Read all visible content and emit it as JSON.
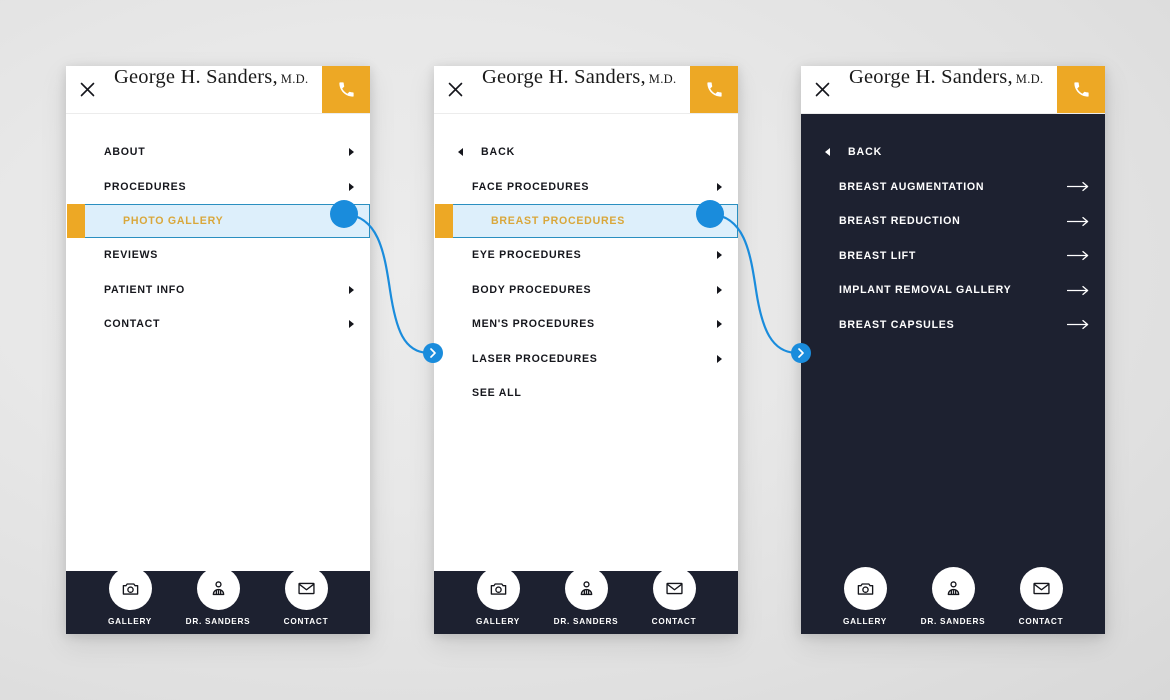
{
  "theme": {
    "accent_orange": "#eda825",
    "highlight_blue_bg": "#ddeffb",
    "highlight_blue_border": "#2a8fc0",
    "connector_blue": "#1a8cdc",
    "dark": "#1d2130",
    "gold_text": "#d9a73b",
    "page_background": "#e6e6e6"
  },
  "brand": {
    "name": "George H. Sanders,",
    "suffix": "M.D.",
    "close_icon": "close-icon",
    "phone_icon": "phone-icon"
  },
  "footer": {
    "items": [
      {
        "label": "Gallery",
        "display": "GALLERY",
        "icon": "camera-icon"
      },
      {
        "label": "Dr. Sanders",
        "display": "DR. SANDERS",
        "icon": "doctor-icon"
      },
      {
        "label": "Contact",
        "display": "CONTACT",
        "icon": "envelope-icon"
      }
    ]
  },
  "panels": [
    {
      "id": "main-menu",
      "theme": "light",
      "items": [
        {
          "label": "ABOUT",
          "arrow": "triangle-right",
          "state": "normal"
        },
        {
          "label": "PROCEDURES",
          "arrow": "triangle-right",
          "state": "normal"
        },
        {
          "label": "PHOTO GALLERY",
          "arrow": "triangle-right",
          "state": "active"
        },
        {
          "label": "REVIEWS",
          "arrow": "none",
          "state": "normal"
        },
        {
          "label": "PATIENT INFO",
          "arrow": "triangle-right",
          "state": "normal"
        },
        {
          "label": "CONTACT",
          "arrow": "triangle-right",
          "state": "normal"
        }
      ]
    },
    {
      "id": "procedures-menu",
      "theme": "light",
      "items": [
        {
          "label": "BACK",
          "arrow": "triangle-left",
          "state": "back"
        },
        {
          "label": "FACE PROCEDURES",
          "arrow": "triangle-right",
          "state": "normal"
        },
        {
          "label": "BREAST PROCEDURES",
          "arrow": "triangle-right",
          "state": "active"
        },
        {
          "label": "EYE PROCEDURES",
          "arrow": "triangle-right",
          "state": "normal"
        },
        {
          "label": "BODY PROCEDURES",
          "arrow": "triangle-right",
          "state": "normal"
        },
        {
          "label": "MEN'S PROCEDURES",
          "arrow": "triangle-right",
          "state": "normal"
        },
        {
          "label": "LASER PROCEDURES",
          "arrow": "triangle-right",
          "state": "normal"
        },
        {
          "label": "SEE ALL",
          "arrow": "none",
          "state": "normal"
        }
      ]
    },
    {
      "id": "breast-procedures-menu",
      "theme": "dark",
      "items": [
        {
          "label": "BACK",
          "arrow": "triangle-left",
          "state": "back"
        },
        {
          "label": "BREAST AUGMENTATION",
          "arrow": "long-arrow-right",
          "state": "normal"
        },
        {
          "label": "BREAST REDUCTION",
          "arrow": "long-arrow-right",
          "state": "normal"
        },
        {
          "label": "BREAST LIFT",
          "arrow": "long-arrow-right",
          "state": "normal"
        },
        {
          "label": "IMPLANT REMOVAL GALLERY",
          "arrow": "long-arrow-right",
          "state": "normal"
        },
        {
          "label": "BREAST CAPSULES",
          "arrow": "long-arrow-right",
          "state": "normal"
        }
      ]
    }
  ],
  "connectors": [
    {
      "from": "panel1-photo-gallery",
      "to": "panel2",
      "start_icon": "source-dot",
      "end_icon": "chevron-right-icon"
    },
    {
      "from": "panel2-breast-procedures",
      "to": "panel3",
      "start_icon": "source-dot",
      "end_icon": "chevron-right-icon"
    }
  ]
}
